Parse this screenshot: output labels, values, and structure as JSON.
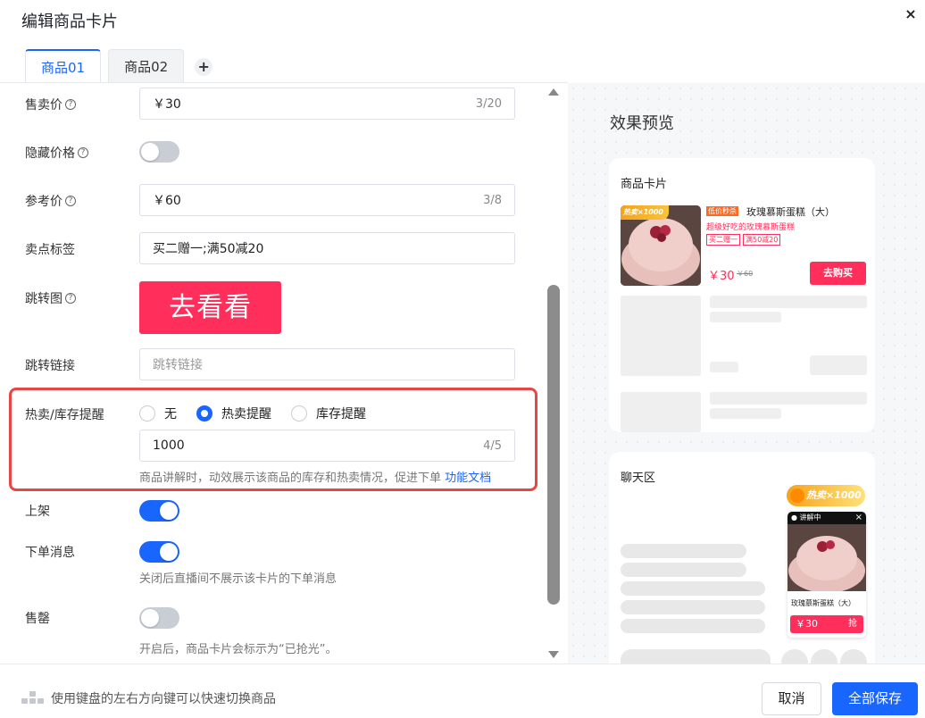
{
  "dialog": {
    "title": "编辑商品卡片",
    "close_icon": "×"
  },
  "tabs": [
    {
      "label": "商品01"
    },
    {
      "label": "商品02"
    }
  ],
  "tab_add_label": "+",
  "form": {
    "sale_price": {
      "label": "售卖价",
      "value": "￥30",
      "count": "3/20"
    },
    "hide_price": {
      "label": "隐藏价格"
    },
    "ref_price": {
      "label": "参考价",
      "value": "￥60",
      "count": "3/8"
    },
    "selling_tag": {
      "label": "卖点标签",
      "value": "买二赠一;满50减20"
    },
    "jump_image": {
      "label": "跳转图",
      "image_text": "去看看"
    },
    "jump_link": {
      "label": "跳转链接",
      "placeholder": "跳转链接"
    },
    "hot_stock": {
      "label": "热卖/库存提醒",
      "options": [
        "无",
        "热卖提醒",
        "库存提醒"
      ],
      "selected": "热卖提醒",
      "value": "1000",
      "count": "4/5",
      "hint": "商品讲解时，动效展示该商品的库存和热卖情况，促进下单",
      "doc_link": "功能文档"
    },
    "on_shelf": {
      "label": "上架"
    },
    "order_msg": {
      "label": "下单消息",
      "hint": "关闭后直播间不展示该卡片的下单消息"
    },
    "sold_out": {
      "label": "售罄",
      "hint": "开启后，商品卡片会标示为“已抢光”。"
    }
  },
  "preview": {
    "title": "效果预览",
    "product_card": {
      "label": "商品卡片",
      "hot_tag": "热卖×1000",
      "promo_badge": "低价秒杀",
      "name": "玫瑰慕斯蛋糕（大）",
      "subtitle": "超级好吃的玫瑰慕斯蛋糕",
      "tags": [
        "买二赠一",
        "满50减20"
      ],
      "price": "￥30",
      "ref_price": "￥60",
      "buy_label": "去购买"
    },
    "chat": {
      "label": "聊天区",
      "hot_tag": "热卖×1000",
      "live_label": "讲解中",
      "name": "玫瑰慕斯蛋糕（大）",
      "price": "￥30",
      "grab_label": "抢"
    }
  },
  "footer": {
    "tip": "使用键盘的左右方向键可以快速切换商品",
    "cancel_label": "取消",
    "save_label": "全部保存"
  },
  "colors": {
    "primary": "#1966ff",
    "accent_red": "#ff2e5a",
    "highlight_border": "#e84545"
  }
}
